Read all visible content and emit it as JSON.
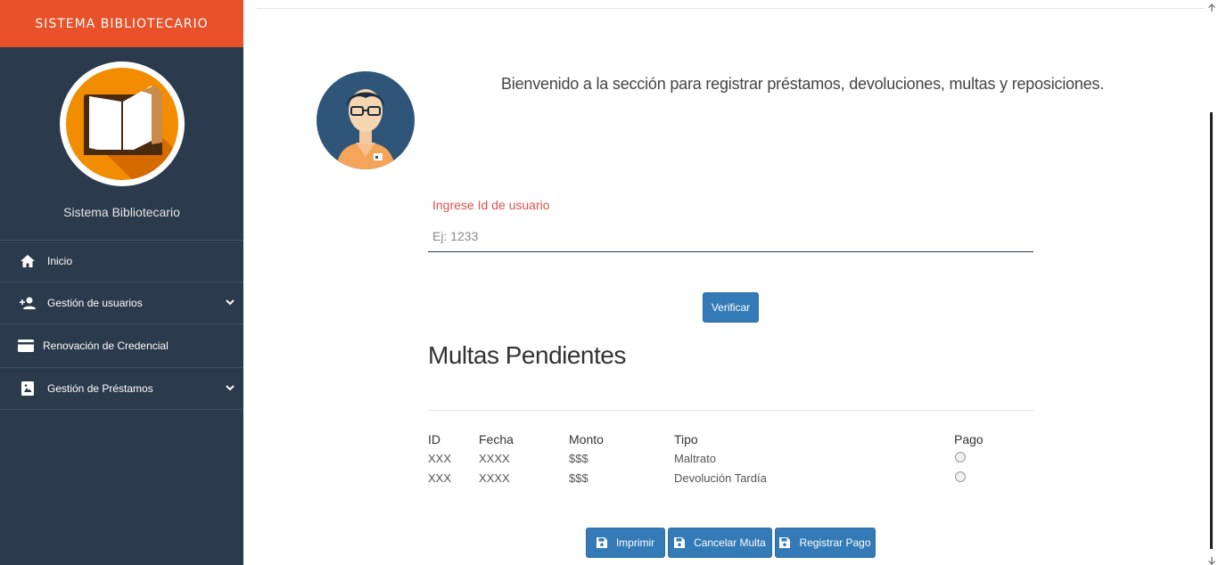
{
  "sidebar": {
    "brand": "SISTEMA BIBLIOTECARIO",
    "system_name": "Sistema Bibliotecario",
    "items": [
      {
        "label": "Inicio",
        "icon": "home-icon"
      },
      {
        "label": "Gestión de usuarios",
        "icon": "add-user-icon",
        "expandable": true
      },
      {
        "label": "Renovación de Credencial",
        "icon": "credit-card-icon"
      },
      {
        "label": "Gestión de Préstamos",
        "icon": "book-icon",
        "expandable": true
      }
    ]
  },
  "main": {
    "welcome": "Bienvenido a la sección para registrar préstamos, devoluciones, multas y reposiciones.",
    "user_field": {
      "label": "Ingrese Id de usuario",
      "placeholder": "Ej: 1233",
      "value": ""
    },
    "verify_button": "Verificar",
    "section_title": "Multas Pendientes",
    "table": {
      "headers": [
        "ID",
        "Fecha",
        "Monto",
        "Tipo",
        "Pago"
      ],
      "rows": [
        {
          "id": "XXX",
          "fecha": "XXXX",
          "monto": "$$$",
          "tipo": "Maltrato",
          "pago": false
        },
        {
          "id": "XXX",
          "fecha": "XXXX",
          "monto": "$$$",
          "tipo": "Devolución Tardía",
          "pago": false
        }
      ]
    },
    "actions": {
      "print": "Imprimir",
      "cancel": "Cancelar Multa",
      "register": "Registrar Pago"
    }
  },
  "colors": {
    "brand": "#e8512a",
    "sidebar": "#2b3a4c",
    "primary": "#337ab7",
    "label": "#d9534f"
  }
}
